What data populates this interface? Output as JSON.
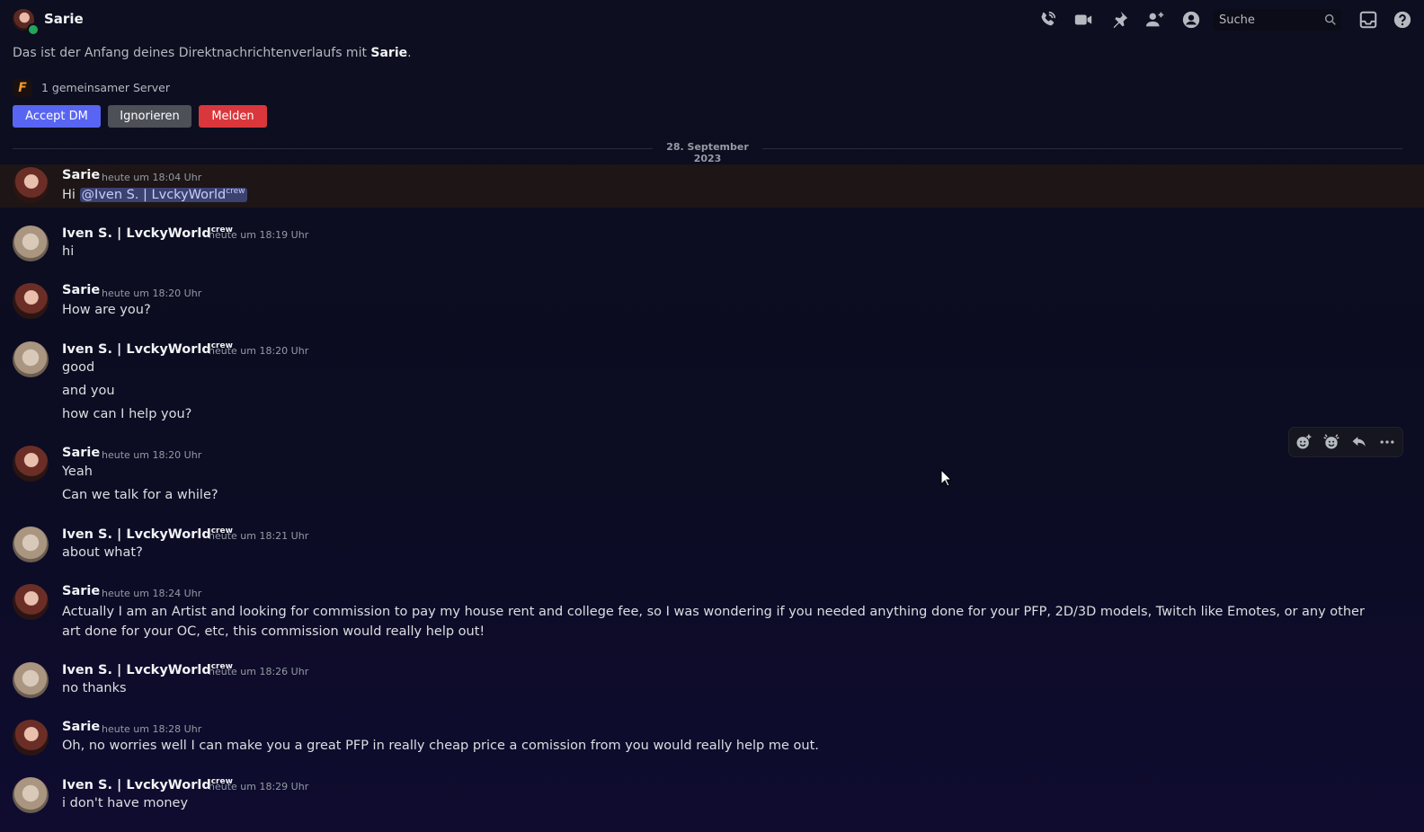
{
  "header": {
    "title": "Sarie",
    "search_placeholder": "Suche",
    "icons": [
      "voice-call-icon",
      "video-call-icon",
      "pin-icon",
      "add-friend-icon",
      "user-profile-icon",
      "search-icon",
      "inbox-icon",
      "help-icon"
    ]
  },
  "intro": {
    "prefix": "Das ist der Anfang deines Direktnachrichtenverlaufs mit ",
    "name": "Sarie",
    "suffix": "."
  },
  "mutual": {
    "server_initial": "F",
    "text": "1 gemeinsamer Server"
  },
  "actions": {
    "accept": "Accept DM",
    "ignore": "Ignorieren",
    "report": "Melden"
  },
  "date_divider": "28. September 2023",
  "tag": "crew",
  "messages": [
    {
      "author": "Sarie",
      "time": "heute um 18:04 Uhr",
      "lines": [
        "Hi "
      ],
      "mention": "@Iven S. | LvckyWorld"
    },
    {
      "author": "Iven S. | LvckyWorld",
      "time": "heute um 18:19 Uhr",
      "lines": [
        "hi"
      ]
    },
    {
      "author": "Sarie",
      "time": "heute um 18:20 Uhr",
      "lines": [
        "How are you?"
      ]
    },
    {
      "author": "Iven S. | LvckyWorld",
      "time": "heute um 18:20 Uhr",
      "lines": [
        "good",
        "and you",
        "how can I help you?"
      ]
    },
    {
      "author": "Sarie",
      "time": "heute um 18:20 Uhr",
      "lines": [
        "Yeah",
        "Can we talk for a while?"
      ]
    },
    {
      "author": "Iven S. | LvckyWorld",
      "time": "heute um 18:21 Uhr",
      "lines": [
        "about what?"
      ]
    },
    {
      "author": "Sarie",
      "time": "heute um 18:24 Uhr",
      "lines": [
        "Actually I am an Artist and looking for commission to pay my house rent and college fee, so I was wondering if you needed anything done for your PFP, 2D/3D models, Twitch like Emotes, or any other art done for your OC, etc, this commission would really help out!"
      ]
    },
    {
      "author": "Iven S. | LvckyWorld",
      "time": "heute um 18:26 Uhr",
      "lines": [
        "no thanks"
      ]
    },
    {
      "author": "Sarie",
      "time": "heute um 18:28 Uhr",
      "lines": [
        "Oh, no worries well I can make you a great PFP in really cheap price a comission from you would really help me out."
      ]
    },
    {
      "author": "Iven S. | LvckyWorld",
      "time": "heute um 18:29 Uhr",
      "lines": [
        "i don't have money"
      ]
    }
  ],
  "hover_toolbar": [
    "add-reaction-icon",
    "super-reaction-icon",
    "reply-icon",
    "more-options-icon"
  ],
  "colors": {
    "accent": "#5865f2",
    "danger": "#da373c",
    "neutral": "#4e5058",
    "online": "#23a55a"
  }
}
